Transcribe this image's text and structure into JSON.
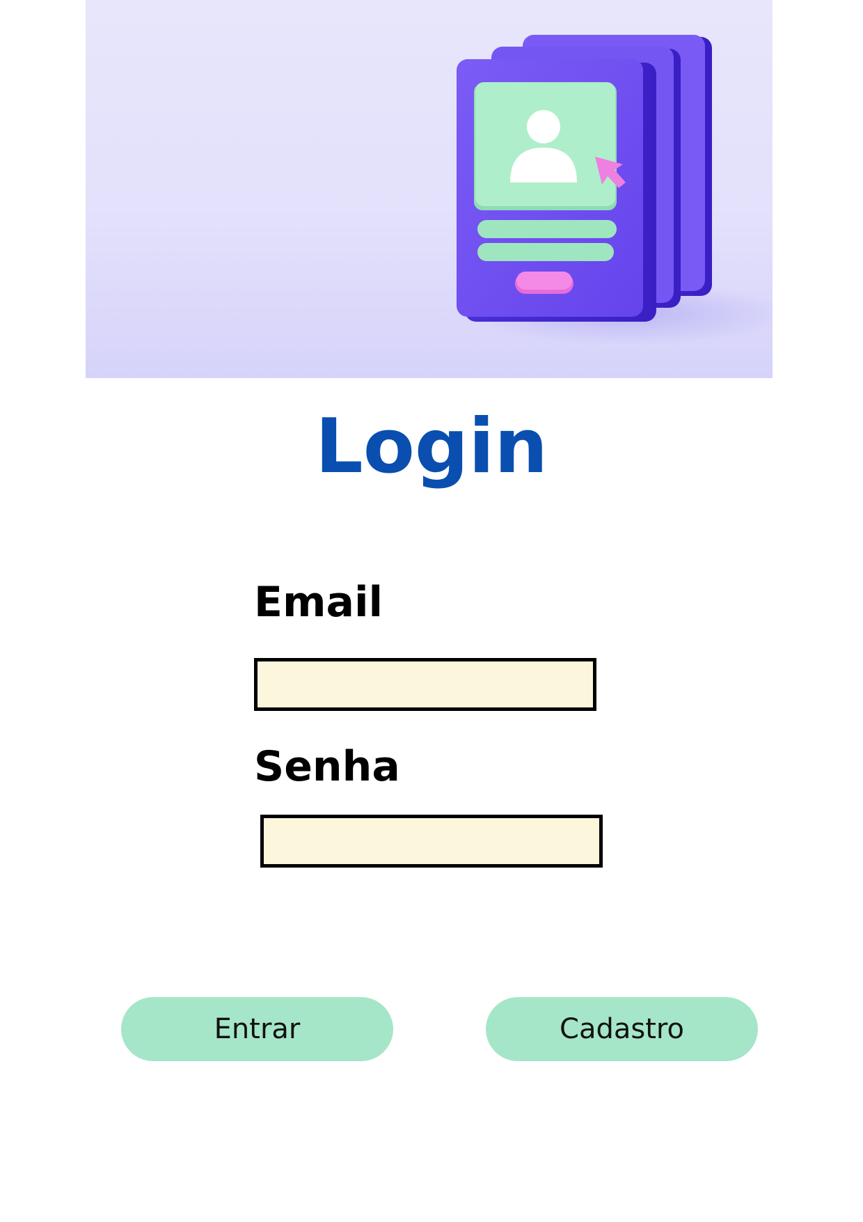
{
  "hero": {
    "illustration_icon": "profile-cards-icon",
    "colors": {
      "background": "#e6e4fb",
      "card": "#6a4cf0",
      "card_screen": "#a7ecc4",
      "button": "#ef7fe0"
    }
  },
  "title": "Login",
  "form": {
    "email": {
      "label": "Email",
      "value": ""
    },
    "password": {
      "label": "Senha",
      "value": ""
    }
  },
  "buttons": {
    "enter_label": "Entrar",
    "register_label": "Cadastro"
  },
  "colors": {
    "title": "#0a4fb0",
    "input_fill": "#fbf6dc",
    "button_fill": "#a6e6c8"
  }
}
